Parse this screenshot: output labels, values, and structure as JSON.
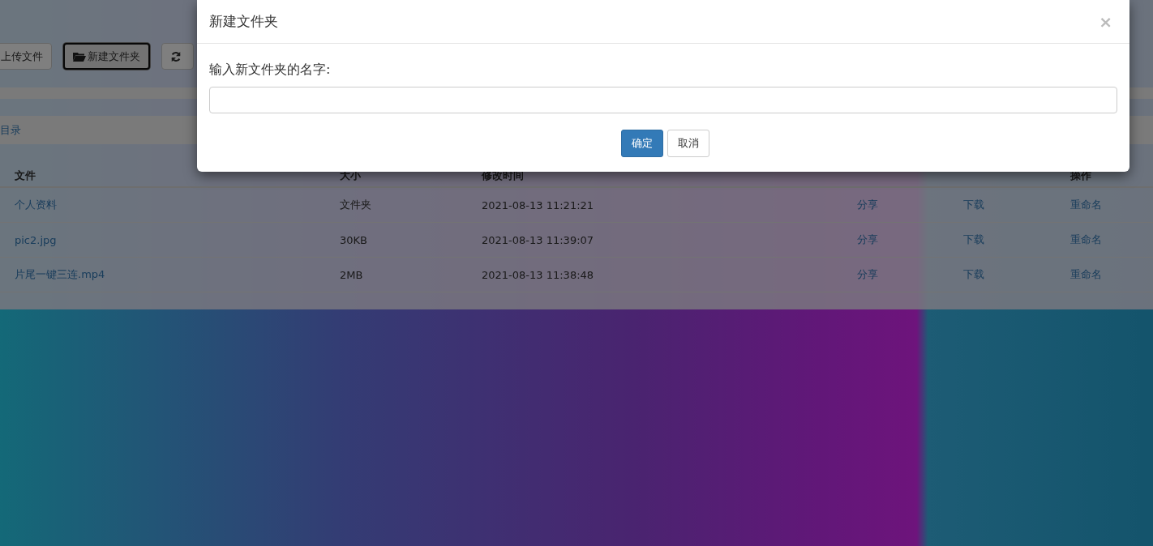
{
  "toolbar": {
    "upload_button": "上传文件",
    "new_folder_button": {
      "label": "新建文件夹",
      "focused": true
    }
  },
  "upload_progress": {
    "level": 0
  },
  "breadcrumb": "目录",
  "table": {
    "columns": {
      "file": "文件",
      "size": "大小",
      "modified": "修改时间",
      "actions": "操作"
    },
    "rows": [
      {
        "name": "个人资料",
        "size": "文件夹",
        "modified": "2021-08-13 11:21:21",
        "actions": [
          "分享",
          "下载",
          "重命名"
        ]
      },
      {
        "name": "pic2.jpg",
        "size": "30KB",
        "modified": "2021-08-13 11:39:07",
        "actions": [
          "分享",
          "下载",
          "重命名"
        ]
      },
      {
        "name": "片尾一键三连.mp4",
        "size": "2MB",
        "modified": "2021-08-13 11:38:48",
        "actions": [
          "分享",
          "下载",
          "重命名"
        ]
      }
    ]
  },
  "dialog": {
    "title": "新建文件夹",
    "close": "×",
    "label": "输入新文件夹的名字:",
    "buttons": [
      {
        "label": "确定",
        "kind": "primary"
      },
      {
        "label": "取消",
        "kind": "default"
      }
    ]
  }
}
